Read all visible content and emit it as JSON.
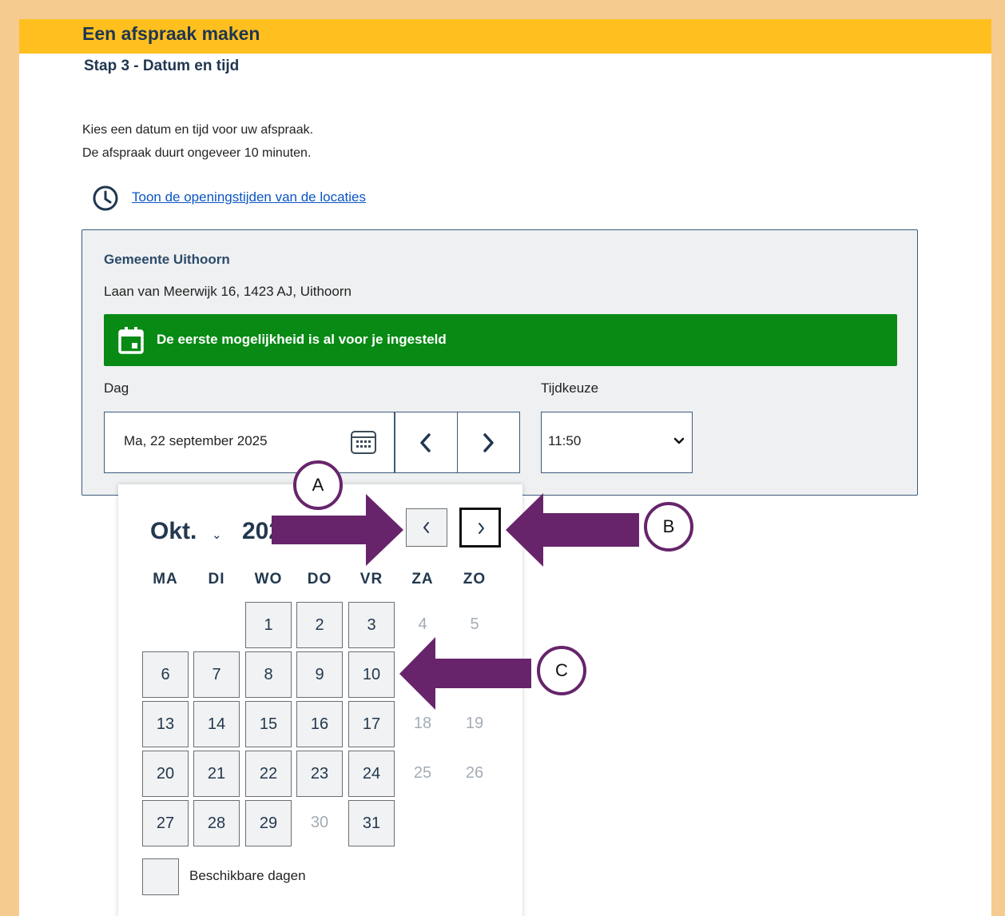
{
  "header": {
    "title": "Een afspraak maken",
    "step": "Stap 3 - Datum en tijd"
  },
  "intro": {
    "line1": "Kies een datum en tijd voor uw afspraak.",
    "line2": "De afspraak duurt ongeveer 10 minuten."
  },
  "opening_hours_link": "Toon de openingstijden van de locaties",
  "location": {
    "name": "Gemeente Uithoorn",
    "address": "Laan van Meerwijk 16, 1423 AJ, Uithoorn"
  },
  "banner": {
    "text": "De eerste mogelijkheid is al voor je ingesteld"
  },
  "day_field": {
    "label": "Dag",
    "value": "Ma, 22 september 2025"
  },
  "time_field": {
    "label": "Tijdkeuze",
    "value": "11:50"
  },
  "datepicker": {
    "month": "Okt.",
    "year": "2025",
    "weekdays": [
      "MA",
      "DI",
      "WO",
      "DO",
      "VR",
      "ZA",
      "ZO"
    ],
    "weeks": [
      [
        null,
        null,
        {
          "d": "1",
          "a": true
        },
        {
          "d": "2",
          "a": true
        },
        {
          "d": "3",
          "a": true
        },
        {
          "d": "4",
          "a": false
        },
        {
          "d": "5",
          "a": false
        }
      ],
      [
        {
          "d": "6",
          "a": true
        },
        {
          "d": "7",
          "a": true
        },
        {
          "d": "8",
          "a": true
        },
        {
          "d": "9",
          "a": true
        },
        {
          "d": "10",
          "a": true
        },
        null,
        null
      ],
      [
        {
          "d": "13",
          "a": true
        },
        {
          "d": "14",
          "a": true
        },
        {
          "d": "15",
          "a": true
        },
        {
          "d": "16",
          "a": true
        },
        {
          "d": "17",
          "a": true
        },
        {
          "d": "18",
          "a": false
        },
        {
          "d": "19",
          "a": false
        }
      ],
      [
        {
          "d": "20",
          "a": true
        },
        {
          "d": "21",
          "a": true
        },
        {
          "d": "22",
          "a": true
        },
        {
          "d": "23",
          "a": true
        },
        {
          "d": "24",
          "a": true
        },
        {
          "d": "25",
          "a": false
        },
        {
          "d": "26",
          "a": false
        }
      ],
      [
        {
          "d": "27",
          "a": true
        },
        {
          "d": "28",
          "a": true
        },
        {
          "d": "29",
          "a": true
        },
        {
          "d": "30",
          "a": false
        },
        {
          "d": "31",
          "a": true
        },
        null,
        null
      ]
    ],
    "legend": "Beschikbare dagen"
  },
  "annotations": {
    "a": "A",
    "b": "B",
    "c": "C"
  },
  "colors": {
    "frame": "#f5cb90",
    "header_bar": "#ffc01f",
    "banner": "#088a15",
    "annotation": "#67246b",
    "link": "#0b55c4"
  }
}
